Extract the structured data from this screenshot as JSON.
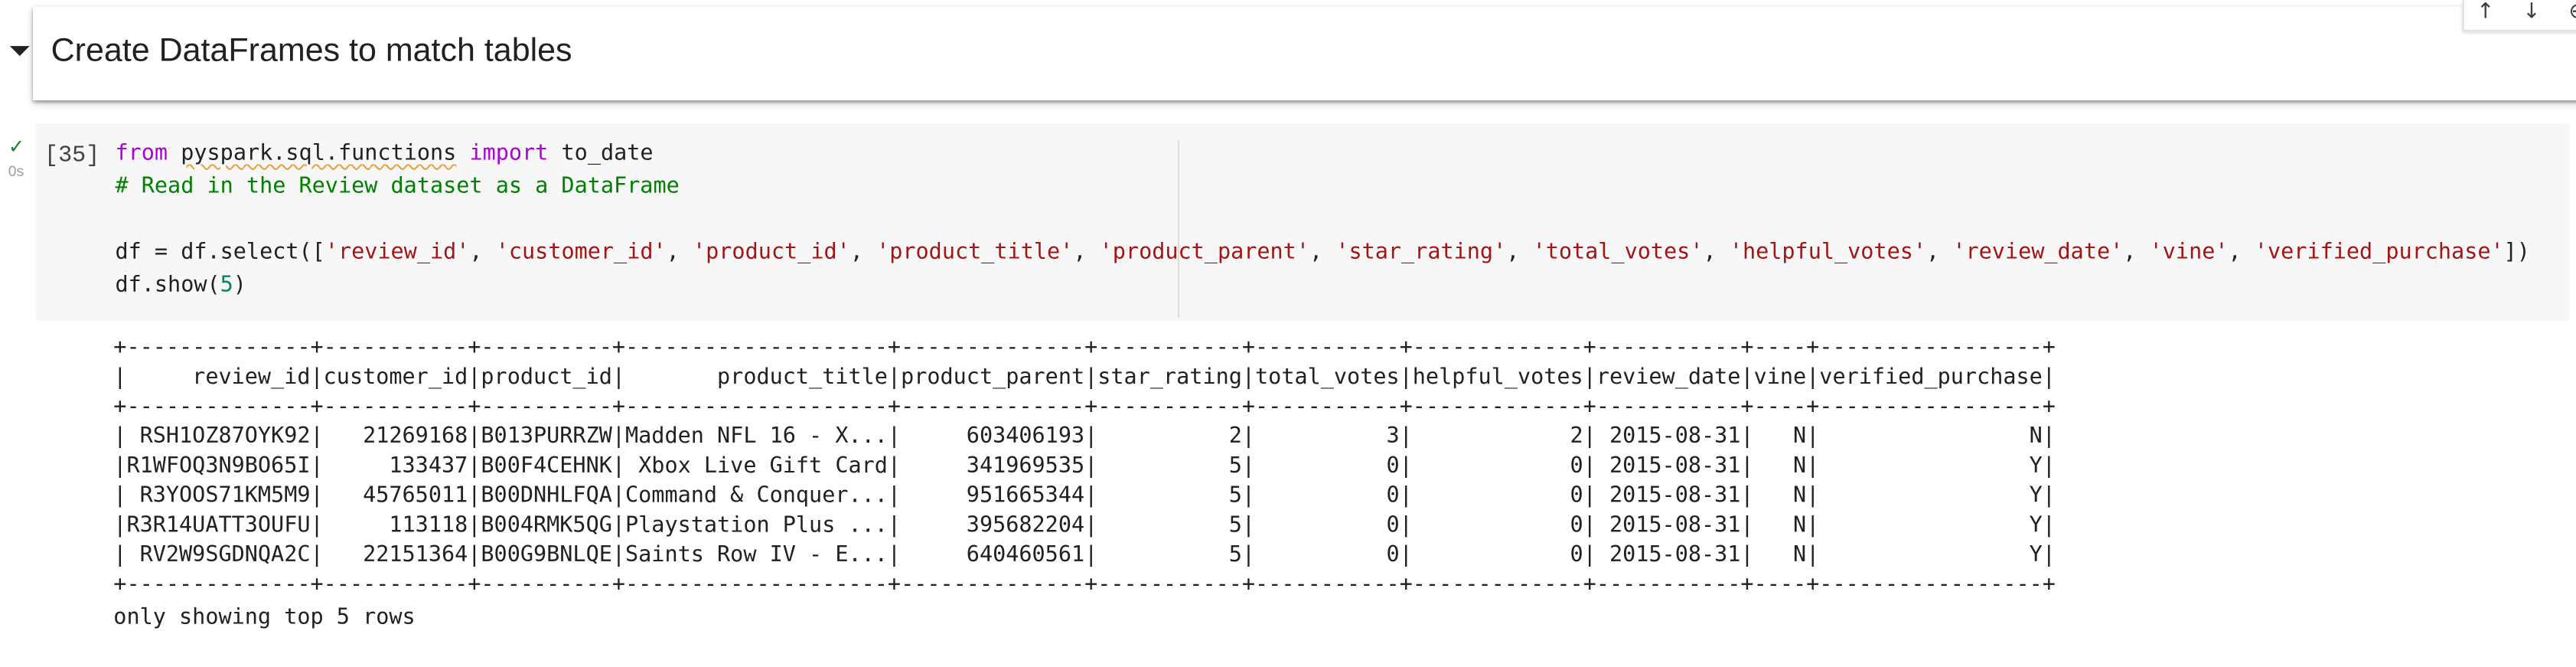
{
  "markdown_cell": {
    "title": "Create DataFrames to match tables",
    "collapse_icon": "caret-down-icon"
  },
  "cell_toolbar": {
    "icons": [
      "arrow-up-icon",
      "arrow-down-icon",
      "link-icon"
    ]
  },
  "code_cell": {
    "execution_count": "[35]",
    "status": "✓",
    "duration": "0s",
    "lines": [
      "from pyspark.sql.functions import to_date",
      "# Read in the Review dataset as a DataFrame",
      "",
      "df = df.select(['review_id', 'customer_id', 'product_id', 'product_title', 'product_parent', 'star_rating', 'total_votes', 'helpful_votes', 'review_date', 'vine', 'verified_purchase'])",
      "df.show(5)"
    ]
  },
  "output": {
    "columns": [
      "review_id",
      "customer_id",
      "product_id",
      "product_title",
      "product_parent",
      "star_rating",
      "total_votes",
      "helpful_votes",
      "review_date",
      "vine",
      "verified_purchase"
    ],
    "rows": [
      [
        "RSH1OZ87OYK92",
        "21269168",
        "B013PURRZW",
        "Madden NFL 16 - X...",
        "603406193",
        "2",
        "3",
        "2",
        "2015-08-31",
        "N",
        "N"
      ],
      [
        "R1WFOQ3N9BO65I",
        "133437",
        "B00F4CEHNK",
        "Xbox Live Gift Card",
        "341969535",
        "5",
        "0",
        "0",
        "2015-08-31",
        "N",
        "Y"
      ],
      [
        "R3YOOS71KM5M9",
        "45765011",
        "B00DNHLFQA",
        "Command & Conquer...",
        "951665344",
        "5",
        "0",
        "0",
        "2015-08-31",
        "N",
        "Y"
      ],
      [
        "R3R14UATT3OUFU",
        "113118",
        "B004RMK5QG",
        "Playstation Plus ...",
        "395682204",
        "5",
        "0",
        "0",
        "2015-08-31",
        "N",
        "Y"
      ],
      [
        "RV2W9SGDNQA2C",
        "22151364",
        "B00G9BNLQE",
        "Saints Row IV - E...",
        "640460561",
        "5",
        "0",
        "0",
        "2015-08-31",
        "N",
        "Y"
      ]
    ],
    "footer": "only showing top 5 rows"
  }
}
